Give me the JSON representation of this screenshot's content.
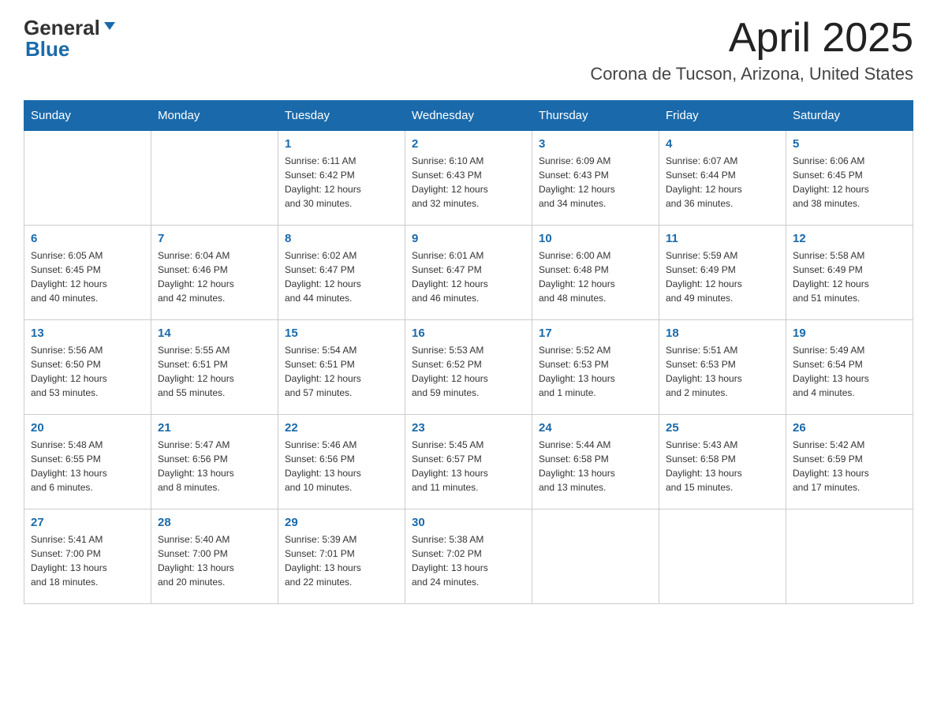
{
  "header": {
    "logo_general": "General",
    "logo_blue": "Blue",
    "title": "April 2025",
    "subtitle": "Corona de Tucson, Arizona, United States"
  },
  "days_of_week": [
    "Sunday",
    "Monday",
    "Tuesday",
    "Wednesday",
    "Thursday",
    "Friday",
    "Saturday"
  ],
  "weeks": [
    [
      {
        "day": "",
        "info": ""
      },
      {
        "day": "",
        "info": ""
      },
      {
        "day": "1",
        "info": "Sunrise: 6:11 AM\nSunset: 6:42 PM\nDaylight: 12 hours\nand 30 minutes."
      },
      {
        "day": "2",
        "info": "Sunrise: 6:10 AM\nSunset: 6:43 PM\nDaylight: 12 hours\nand 32 minutes."
      },
      {
        "day": "3",
        "info": "Sunrise: 6:09 AM\nSunset: 6:43 PM\nDaylight: 12 hours\nand 34 minutes."
      },
      {
        "day": "4",
        "info": "Sunrise: 6:07 AM\nSunset: 6:44 PM\nDaylight: 12 hours\nand 36 minutes."
      },
      {
        "day": "5",
        "info": "Sunrise: 6:06 AM\nSunset: 6:45 PM\nDaylight: 12 hours\nand 38 minutes."
      }
    ],
    [
      {
        "day": "6",
        "info": "Sunrise: 6:05 AM\nSunset: 6:45 PM\nDaylight: 12 hours\nand 40 minutes."
      },
      {
        "day": "7",
        "info": "Sunrise: 6:04 AM\nSunset: 6:46 PM\nDaylight: 12 hours\nand 42 minutes."
      },
      {
        "day": "8",
        "info": "Sunrise: 6:02 AM\nSunset: 6:47 PM\nDaylight: 12 hours\nand 44 minutes."
      },
      {
        "day": "9",
        "info": "Sunrise: 6:01 AM\nSunset: 6:47 PM\nDaylight: 12 hours\nand 46 minutes."
      },
      {
        "day": "10",
        "info": "Sunrise: 6:00 AM\nSunset: 6:48 PM\nDaylight: 12 hours\nand 48 minutes."
      },
      {
        "day": "11",
        "info": "Sunrise: 5:59 AM\nSunset: 6:49 PM\nDaylight: 12 hours\nand 49 minutes."
      },
      {
        "day": "12",
        "info": "Sunrise: 5:58 AM\nSunset: 6:49 PM\nDaylight: 12 hours\nand 51 minutes."
      }
    ],
    [
      {
        "day": "13",
        "info": "Sunrise: 5:56 AM\nSunset: 6:50 PM\nDaylight: 12 hours\nand 53 minutes."
      },
      {
        "day": "14",
        "info": "Sunrise: 5:55 AM\nSunset: 6:51 PM\nDaylight: 12 hours\nand 55 minutes."
      },
      {
        "day": "15",
        "info": "Sunrise: 5:54 AM\nSunset: 6:51 PM\nDaylight: 12 hours\nand 57 minutes."
      },
      {
        "day": "16",
        "info": "Sunrise: 5:53 AM\nSunset: 6:52 PM\nDaylight: 12 hours\nand 59 minutes."
      },
      {
        "day": "17",
        "info": "Sunrise: 5:52 AM\nSunset: 6:53 PM\nDaylight: 13 hours\nand 1 minute."
      },
      {
        "day": "18",
        "info": "Sunrise: 5:51 AM\nSunset: 6:53 PM\nDaylight: 13 hours\nand 2 minutes."
      },
      {
        "day": "19",
        "info": "Sunrise: 5:49 AM\nSunset: 6:54 PM\nDaylight: 13 hours\nand 4 minutes."
      }
    ],
    [
      {
        "day": "20",
        "info": "Sunrise: 5:48 AM\nSunset: 6:55 PM\nDaylight: 13 hours\nand 6 minutes."
      },
      {
        "day": "21",
        "info": "Sunrise: 5:47 AM\nSunset: 6:56 PM\nDaylight: 13 hours\nand 8 minutes."
      },
      {
        "day": "22",
        "info": "Sunrise: 5:46 AM\nSunset: 6:56 PM\nDaylight: 13 hours\nand 10 minutes."
      },
      {
        "day": "23",
        "info": "Sunrise: 5:45 AM\nSunset: 6:57 PM\nDaylight: 13 hours\nand 11 minutes."
      },
      {
        "day": "24",
        "info": "Sunrise: 5:44 AM\nSunset: 6:58 PM\nDaylight: 13 hours\nand 13 minutes."
      },
      {
        "day": "25",
        "info": "Sunrise: 5:43 AM\nSunset: 6:58 PM\nDaylight: 13 hours\nand 15 minutes."
      },
      {
        "day": "26",
        "info": "Sunrise: 5:42 AM\nSunset: 6:59 PM\nDaylight: 13 hours\nand 17 minutes."
      }
    ],
    [
      {
        "day": "27",
        "info": "Sunrise: 5:41 AM\nSunset: 7:00 PM\nDaylight: 13 hours\nand 18 minutes."
      },
      {
        "day": "28",
        "info": "Sunrise: 5:40 AM\nSunset: 7:00 PM\nDaylight: 13 hours\nand 20 minutes."
      },
      {
        "day": "29",
        "info": "Sunrise: 5:39 AM\nSunset: 7:01 PM\nDaylight: 13 hours\nand 22 minutes."
      },
      {
        "day": "30",
        "info": "Sunrise: 5:38 AM\nSunset: 7:02 PM\nDaylight: 13 hours\nand 24 minutes."
      },
      {
        "day": "",
        "info": ""
      },
      {
        "day": "",
        "info": ""
      },
      {
        "day": "",
        "info": ""
      }
    ]
  ]
}
